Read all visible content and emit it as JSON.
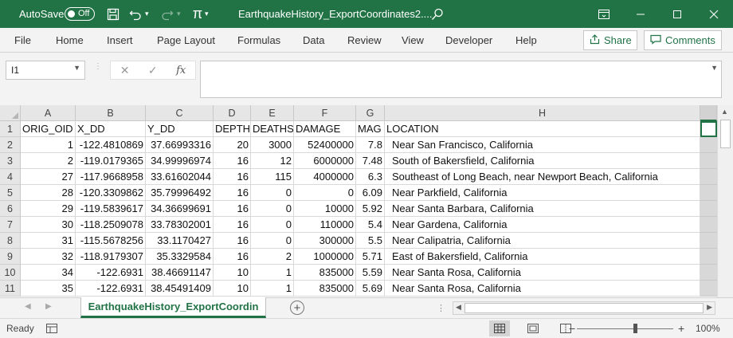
{
  "titlebar": {
    "autosave_label": "AutoSave",
    "autosave_state": "Off",
    "doc_title": "EarthquakeHistory_ExportCoordinates2....",
    "icons": [
      "save-icon",
      "undo-icon",
      "redo-icon",
      "customize-qat-icon",
      "search-icon",
      "ribbon-display-icon",
      "minimize-icon",
      "maximize-icon",
      "close-icon"
    ]
  },
  "ribbon": {
    "tabs": [
      "File",
      "Home",
      "Insert",
      "Page Layout",
      "Formulas",
      "Data",
      "Review",
      "View",
      "Developer",
      "Help"
    ],
    "share_label": "Share",
    "comments_label": "Comments"
  },
  "formula_bar": {
    "name_box": "I1",
    "fx_label": "fx",
    "formula": ""
  },
  "grid": {
    "columns": [
      "A",
      "B",
      "C",
      "D",
      "E",
      "F",
      "G",
      "H"
    ],
    "rows": [
      "1",
      "2",
      "3",
      "4",
      "5",
      "6",
      "7",
      "8",
      "9",
      "10",
      "11"
    ],
    "header_row": [
      "ORIG_OID",
      "X_DD",
      "Y_DD",
      "DEPTH",
      "DEATHS",
      "DAMAGE",
      "MAG",
      "LOCATION"
    ],
    "data": [
      [
        "1",
        "-122.4810869",
        "37.66993316",
        "20",
        "3000",
        "52400000",
        "7.8",
        "Near San Francisco, California"
      ],
      [
        "2",
        "-119.0179365",
        "34.99996974",
        "16",
        "12",
        "6000000",
        "7.48",
        "South of Bakersfield, California"
      ],
      [
        "27",
        "-117.9668958",
        "33.61602044",
        "16",
        "115",
        "4000000",
        "6.3",
        "Southeast of Long Beach, near Newport Beach, California"
      ],
      [
        "28",
        "-120.3309862",
        "35.79996492",
        "16",
        "0",
        "0",
        "6.09",
        "Near Parkfield, California"
      ],
      [
        "29",
        "-119.5839617",
        "34.36699691",
        "16",
        "0",
        "10000",
        "5.92",
        "Near Santa Barbara, California"
      ],
      [
        "30",
        "-118.2509078",
        "33.78302001",
        "16",
        "0",
        "110000",
        "5.4",
        "Near Gardena, California"
      ],
      [
        "31",
        "-115.5678256",
        "33.1170427",
        "16",
        "0",
        "300000",
        "5.5",
        "Near Calipatria, California"
      ],
      [
        "32",
        "-118.9179307",
        "35.3329584",
        "16",
        "2",
        "1000000",
        "5.71",
        "East of Bakersfield, California"
      ],
      [
        "34",
        "-122.6931",
        "38.46691147",
        "10",
        "1",
        "835000",
        "5.59",
        "Near Santa Rosa, California"
      ],
      [
        "35",
        "-122.6931",
        "38.45491409",
        "10",
        "1",
        "835000",
        "5.69",
        "Near Santa Rosa, California"
      ]
    ]
  },
  "sheet_tabs": {
    "active_tab": "EarthquakeHistory_ExportCoordin"
  },
  "statusbar": {
    "status": "Ready",
    "zoom": "100%",
    "zoom_minus": "−",
    "zoom_plus": "+"
  },
  "colors": {
    "excel_green": "#217346",
    "ribbon_bg": "#f3f3f3"
  }
}
